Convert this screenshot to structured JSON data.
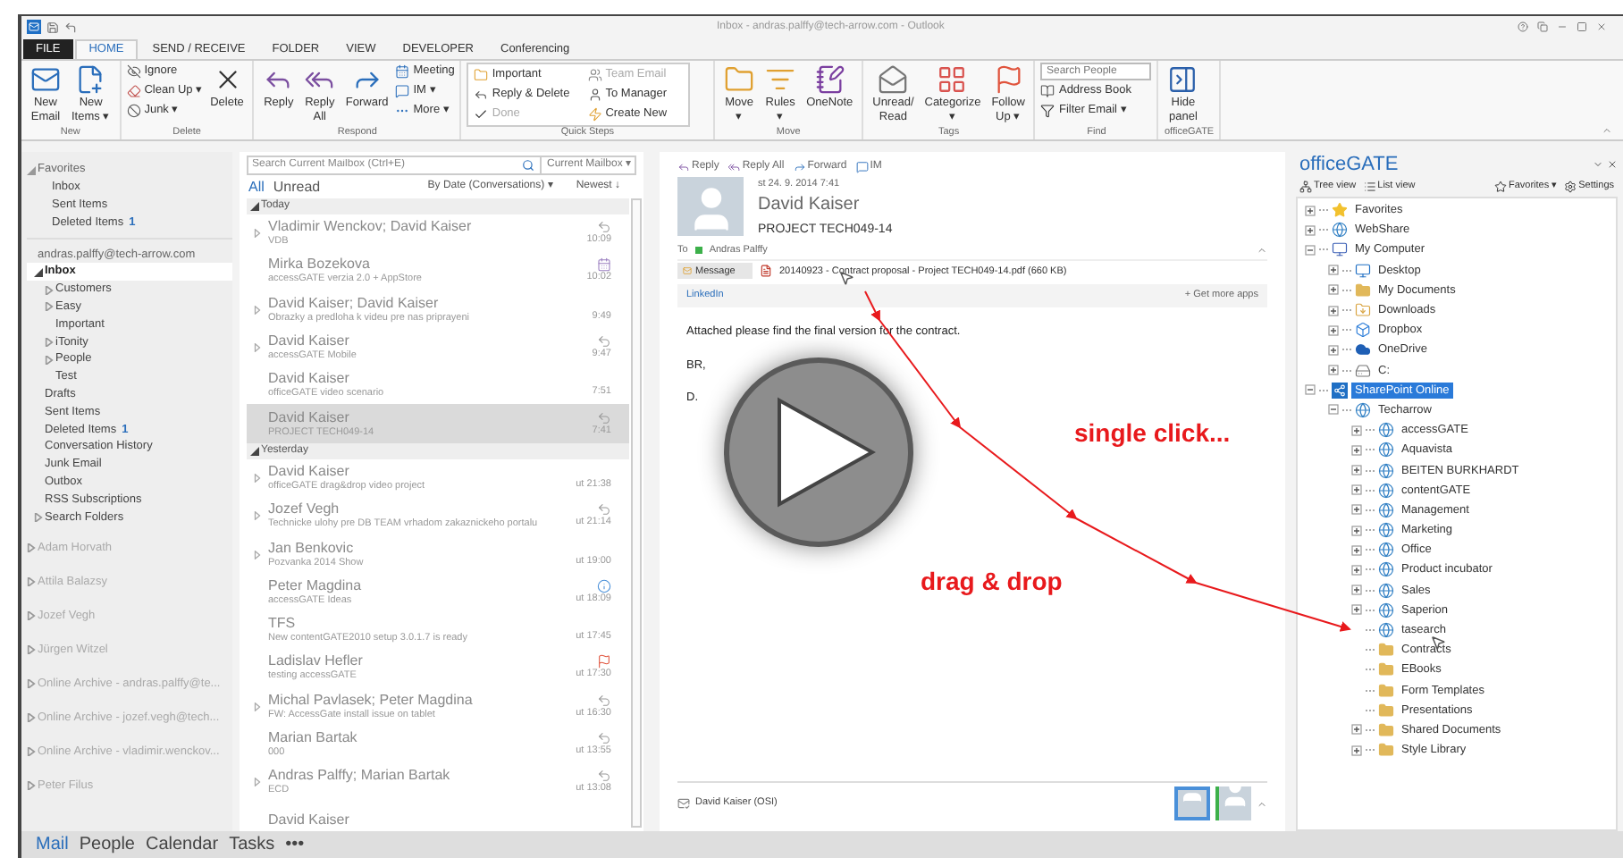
{
  "window": {
    "title": "Inbox - andras.palffy@tech-arrow.com - Outlook"
  },
  "ribbon": {
    "tabs": [
      {
        "label": "FILE",
        "kind": "file",
        "selected": false
      },
      {
        "label": "HOME",
        "kind": "tab",
        "selected": true
      },
      {
        "label": "SEND / RECEIVE",
        "kind": "tab",
        "selected": false
      },
      {
        "label": "FOLDER",
        "kind": "tab",
        "selected": false
      },
      {
        "label": "VIEW",
        "kind": "tab",
        "selected": false
      },
      {
        "label": "DEVELOPER",
        "kind": "tab",
        "selected": false
      },
      {
        "label": "Conferencing",
        "kind": "tab",
        "selected": false
      }
    ],
    "groups": [
      {
        "label": "New",
        "items": [
          {
            "kind": "large",
            "label": "New\nEmail"
          },
          {
            "kind": "large",
            "label": "New\nItems ▾"
          }
        ]
      },
      {
        "label": "Delete",
        "items": [
          {
            "kind": "stack",
            "items": [
              {
                "label": "Ignore"
              },
              {
                "label": "Clean Up ▾"
              },
              {
                "label": "Junk ▾"
              }
            ]
          },
          {
            "kind": "large",
            "label": "Delete"
          }
        ]
      },
      {
        "label": "Respond",
        "items": [
          {
            "kind": "large",
            "label": "Reply"
          },
          {
            "kind": "large",
            "label": "Reply\nAll"
          },
          {
            "kind": "large",
            "label": "Forward"
          },
          {
            "kind": "stack",
            "items": [
              {
                "label": "Meeting"
              },
              {
                "label": "IM ▾"
              },
              {
                "label": "More ▾"
              }
            ]
          }
        ]
      },
      {
        "label": "Quick Steps",
        "items": [
          {
            "kind": "gallery",
            "items": [
              {
                "label": "Important",
                "disabled": false
              },
              {
                "label": "Team Email",
                "disabled": true
              },
              {
                "label": "Reply & Delete",
                "disabled": false
              },
              {
                "label": "To Manager",
                "disabled": false
              },
              {
                "label": "Done",
                "disabled": true
              },
              {
                "label": "Create New",
                "disabled": false
              }
            ]
          }
        ]
      },
      {
        "label": "Move",
        "items": [
          {
            "kind": "large",
            "label": "Move\n▾"
          },
          {
            "kind": "large",
            "label": "Rules\n▾"
          },
          {
            "kind": "large",
            "label": "OneNote"
          }
        ]
      },
      {
        "label": "Tags",
        "items": [
          {
            "kind": "large",
            "label": "Unread/\nRead"
          },
          {
            "kind": "large",
            "label": "Categorize\n▾"
          },
          {
            "kind": "large",
            "label": "Follow\nUp ▾"
          }
        ]
      },
      {
        "label": "Find",
        "items": [
          {
            "kind": "stack",
            "items": [
              {
                "kind": "search",
                "placeholder": "Search People"
              },
              {
                "label": "Address Book"
              },
              {
                "label": "Filter Email ▾"
              }
            ]
          }
        ]
      },
      {
        "label": "officeGATE",
        "items": [
          {
            "kind": "large",
            "label": "Hide\npanel"
          }
        ]
      }
    ]
  },
  "folder_pane": {
    "sections": [
      {
        "label": "Favorites",
        "expanded": true,
        "items": [
          {
            "label": "Inbox",
            "selected": false
          },
          {
            "label": "Sent Items",
            "selected": false
          },
          {
            "label": "Deleted Items",
            "count": "1",
            "selected": false
          }
        ]
      },
      {
        "label": "andras.palffy@tech-arrow.com",
        "items": [
          {
            "label": "Inbox",
            "selected": true,
            "expanded": true,
            "children": [
              {
                "label": "Customers",
                "selected": false,
                "expanded": false
              },
              {
                "label": "Easy",
                "selected": false,
                "expanded": false
              },
              {
                "label": "Important",
                "selected": false
              },
              {
                "label": "iTonity",
                "selected": false,
                "expanded": false
              },
              {
                "label": "People",
                "selected": false,
                "expanded": false
              },
              {
                "label": "Test",
                "selected": false
              }
            ]
          },
          {
            "label": "Drafts",
            "selected": false
          },
          {
            "label": "Sent Items",
            "selected": false
          },
          {
            "label": "Deleted Items",
            "count": "1",
            "selected": false
          },
          {
            "label": "Conversation History",
            "selected": false
          },
          {
            "label": "Junk Email",
            "selected": false
          },
          {
            "label": "Outbox",
            "selected": false
          },
          {
            "label": "RSS Subscriptions",
            "selected": false
          },
          {
            "label": "Search Folders",
            "selected": false,
            "expanded": false
          }
        ]
      }
    ],
    "mailboxes": [
      {
        "label": "Adam Horvath",
        "expanded": false
      },
      {
        "label": "Attila Balazsy",
        "expanded": false
      },
      {
        "label": "Jozef Vegh",
        "expanded": false
      },
      {
        "label": "Jürgen Witzel",
        "expanded": false
      },
      {
        "label": "Online Archive - andras.palffy@te...",
        "expanded": false
      },
      {
        "label": "Online Archive - jozef.vegh@tech...",
        "expanded": false
      },
      {
        "label": "Online Archive - vladimir.wenckov...",
        "expanded": false
      },
      {
        "label": "Peter Filus",
        "expanded": false
      }
    ]
  },
  "nav": [
    {
      "label": "Mail",
      "selected": true
    },
    {
      "label": "People",
      "selected": false
    },
    {
      "label": "Calendar",
      "selected": false
    },
    {
      "label": "Tasks",
      "selected": false
    },
    {
      "label": "•••",
      "selected": false
    }
  ],
  "message_list": {
    "search": {
      "placeholder": "Search Current Mailbox (Ctrl+E)",
      "scope": "Current Mailbox ▾"
    },
    "filters": [
      {
        "label": "All",
        "selected": true
      },
      {
        "label": "Unread",
        "selected": false
      }
    ],
    "sort": "By Date (Conversations) ▾",
    "order": "Newest ↓",
    "groups": [
      {
        "label": "Today",
        "expanded": true,
        "messages": [
          {
            "sender": "Vladimir Wenckov; David Kaiser",
            "subject": "VDB",
            "time": "10:09",
            "expanded": false,
            "kind": "replied",
            "selected": false
          },
          {
            "sender": "Mirka Bozekova",
            "subject": "accessGATE verzia 2.0 + AppStore",
            "time": "10:02",
            "kind": "meeting",
            "selected": false
          },
          {
            "sender": "David Kaiser; David Kaiser",
            "subject": "Obrazky a predloha k videu pre nas priprayeni",
            "time": "9:49",
            "expanded": false,
            "kind": "plain",
            "selected": false
          },
          {
            "sender": "David Kaiser",
            "subject": "accessGATE Mobile",
            "time": "9:47",
            "expanded": false,
            "kind": "replied",
            "selected": false
          },
          {
            "sender": "David Kaiser",
            "subject": "officeGATE video scenario",
            "time": "7:51",
            "kind": "plain",
            "selected": false
          },
          {
            "sender": "David Kaiser",
            "subject": "PROJECT TECH049-14",
            "time": "7:41",
            "kind": "replied",
            "selected": true
          }
        ]
      },
      {
        "label": "Yesterday",
        "expanded": true,
        "messages": [
          {
            "sender": "David Kaiser",
            "subject": "officeGATE drag&drop video project",
            "time": "ut 21:38",
            "expanded": false,
            "kind": "plain",
            "selected": false
          },
          {
            "sender": "Jozef Vegh",
            "subject": "Technicke ulohy pre DB TEAM vrhadom zakaznickeho portalu",
            "time": "ut 21:14",
            "expanded": false,
            "kind": "replied",
            "selected": false
          },
          {
            "sender": "Jan Benkovic",
            "subject": "Pozvanka 2014 Show",
            "time": "ut 19:00",
            "expanded": false,
            "kind": "plain",
            "selected": false
          },
          {
            "sender": "Peter Magdina",
            "subject": "accessGATE Ideas",
            "time": "ut 18:09",
            "kind": "info",
            "selected": false
          },
          {
            "sender": "TFS",
            "subject": "New contentGATE2010 setup 3.0.1.7 is ready",
            "time": "ut 17:45",
            "kind": "plain",
            "selected": false
          },
          {
            "sender": "Ladislav Hefler",
            "subject": "testing accessGATE",
            "time": "ut 17:30",
            "kind": "flagged",
            "selected": false
          },
          {
            "sender": "Michal Pavlasek; Peter Magdina",
            "subject": "FW: AccessGate install issue on tablet",
            "time": "ut 16:30",
            "expanded": false,
            "kind": "replied",
            "selected": false
          },
          {
            "sender": "Marian Bartak",
            "subject": "000",
            "time": "ut 13:55",
            "kind": "replied",
            "selected": false
          },
          {
            "sender": "Andras Palffy; Marian Bartak",
            "subject": "ECD",
            "time": "ut 13:08",
            "expanded": false,
            "kind": "replied",
            "selected": false
          },
          {
            "sender": "David Kaiser",
            "kind": "plain",
            "selected": false
          }
        ]
      }
    ]
  },
  "reading_pane": {
    "actions": [
      "Reply",
      "Reply All",
      "Forward",
      "IM"
    ],
    "date": "st 24. 9. 2014 7:41",
    "sender": "David Kaiser",
    "subject": "PROJECT TECH049-14",
    "to_label": "To",
    "to": "Andras Palffy",
    "message_tab": "Message",
    "attachment": "20140923 - Contract proposal - Project TECH049-14.pdf (660 KB)",
    "apps": "LinkedIn",
    "more_apps": "+ Get more apps",
    "body": [
      "Attached please find the final version for the contract.",
      "BR,",
      "D."
    ],
    "footer": "David Kaiser (OSI)"
  },
  "office_gate": {
    "title": "officeGATE",
    "toolbar": [
      "Tree view",
      "List view",
      "Favorites ▾",
      "Settings"
    ],
    "tree": [
      {
        "label": "Favorites",
        "kind": "star",
        "expanded": false,
        "selected": false
      },
      {
        "label": "WebShare",
        "kind": "globe",
        "expanded": false,
        "selected": false
      },
      {
        "label": "My Computer",
        "kind": "computer",
        "expanded": true,
        "selected": false,
        "children": [
          {
            "label": "Desktop",
            "kind": "desktop",
            "expanded": false,
            "selected": false
          },
          {
            "label": "My Documents",
            "kind": "folder",
            "expanded": false,
            "selected": false
          },
          {
            "label": "Downloads",
            "kind": "download",
            "expanded": false,
            "selected": false
          },
          {
            "label": "Dropbox",
            "kind": "dropbox",
            "expanded": false,
            "selected": false
          },
          {
            "label": "OneDrive",
            "kind": "cloud",
            "expanded": false,
            "selected": false
          },
          {
            "label": "C:",
            "kind": "drive",
            "expanded": false,
            "selected": false
          }
        ]
      },
      {
        "label": "SharePoint Online",
        "kind": "sharepoint",
        "expanded": true,
        "selected": true,
        "children": [
          {
            "label": "Techarrow",
            "kind": "globe",
            "expanded": true,
            "selected": false,
            "children": [
              {
                "label": "accessGATE",
                "kind": "globe",
                "expanded": false,
                "selected": false
              },
              {
                "label": "Aquavista",
                "kind": "globe",
                "expanded": false,
                "selected": false
              },
              {
                "label": "BEITEN BURKHARDT",
                "kind": "globe",
                "expanded": false,
                "selected": false
              },
              {
                "label": "contentGATE",
                "kind": "globe",
                "expanded": false,
                "selected": false
              },
              {
                "label": "Management",
                "kind": "globe",
                "expanded": false,
                "selected": false
              },
              {
                "label": "Marketing",
                "kind": "globe",
                "expanded": false,
                "selected": false
              },
              {
                "label": "Office",
                "kind": "globe",
                "expanded": false,
                "selected": false
              },
              {
                "label": "Product incubator",
                "kind": "globe",
                "expanded": false,
                "selected": false
              },
              {
                "label": "Sales",
                "kind": "globe",
                "expanded": false,
                "selected": false
              },
              {
                "label": "Saperion",
                "kind": "globe",
                "expanded": false,
                "selected": false
              },
              {
                "label": "tasearch",
                "kind": "globe",
                "selected": false
              },
              {
                "label": "Contracts",
                "kind": "folder",
                "selected": false
              },
              {
                "label": "EBooks",
                "kind": "folder",
                "selected": false
              },
              {
                "label": "Form Templates",
                "kind": "folder",
                "selected": false
              },
              {
                "label": "Presentations",
                "kind": "folder",
                "selected": false
              },
              {
                "label": "Shared Documents",
                "kind": "folder",
                "expanded": false,
                "selected": false
              },
              {
                "label": "Style Library",
                "kind": "folder",
                "expanded": false,
                "selected": false
              }
            ]
          }
        ]
      }
    ]
  },
  "annotations": [
    "single click...",
    "drag & drop"
  ]
}
